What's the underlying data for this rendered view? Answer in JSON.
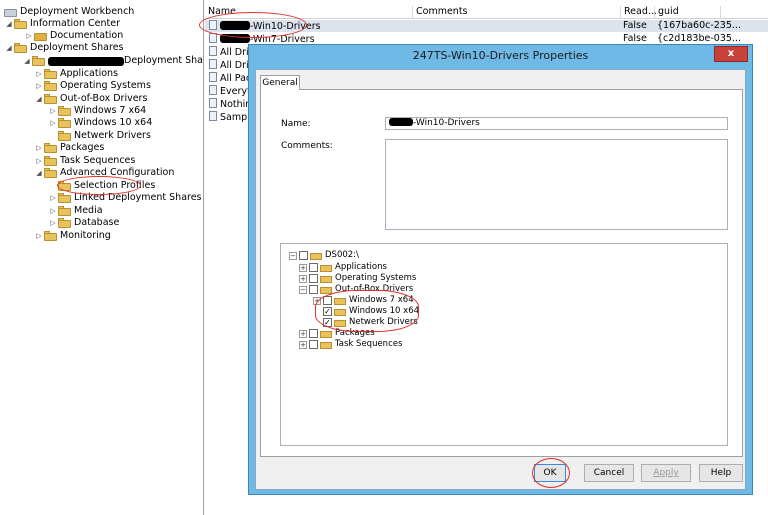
{
  "left_tree": {
    "items": [
      {
        "label": "Deployment Workbench",
        "icon": "workbench-icon"
      },
      {
        "label": "Information Center",
        "icon": "folder-icon"
      },
      {
        "label": "Documentation",
        "icon": "book-icon"
      },
      {
        "label": "Deployment Shares",
        "icon": "folder-icon"
      },
      {
        "label": "Deployment Share (D:\\WDS",
        "icon": "share-icon"
      },
      {
        "label": "Applications",
        "icon": "folder-icon"
      },
      {
        "label": "Operating Systems",
        "icon": "folder-icon"
      },
      {
        "label": "Out-of-Box Drivers",
        "icon": "folder-icon"
      },
      {
        "label": "Windows 7 x64",
        "icon": "folder-icon"
      },
      {
        "label": "Windows 10 x64",
        "icon": "folder-icon"
      },
      {
        "label": "Netwerk Drivers",
        "icon": "folder-icon"
      },
      {
        "label": "Packages",
        "icon": "folder-icon"
      },
      {
        "label": "Task Sequences",
        "icon": "folder-icon"
      },
      {
        "label": "Advanced Configuration",
        "icon": "folder-icon"
      },
      {
        "label": "Selection Profiles",
        "icon": "folder-icon"
      },
      {
        "label": "Linked Deployment Shares",
        "icon": "folder-icon"
      },
      {
        "label": "Media",
        "icon": "folder-icon"
      },
      {
        "label": "Database",
        "icon": "folder-icon"
      },
      {
        "label": "Monitoring",
        "icon": "folder-icon"
      }
    ]
  },
  "list": {
    "columns": [
      "Name",
      "Comments",
      "Read...",
      "guid"
    ],
    "rows": [
      {
        "name": "-Win10-Drivers",
        "read": "False",
        "guid": "{167ba60c-235..."
      },
      {
        "name": "-Win7-Drivers",
        "read": "False",
        "guid": "{c2d183be-035..."
      },
      {
        "name": "All Driv",
        "read": "",
        "guid": ""
      },
      {
        "name": "All Driv",
        "read": "",
        "guid": ""
      },
      {
        "name": "All Pack",
        "read": "",
        "guid": ""
      },
      {
        "name": "Everyth",
        "read": "",
        "guid": ""
      },
      {
        "name": "Nothin",
        "read": "",
        "guid": ""
      },
      {
        "name": "Sample",
        "read": "",
        "guid": ""
      }
    ]
  },
  "dialog": {
    "title": "247TS-Win10-Drivers Properties",
    "close_label": "x",
    "tab_label": "General",
    "name_label": "Name:",
    "name_value": "-Win10-Drivers",
    "comments_label": "Comments:",
    "tree": [
      {
        "label": "DS002:\\",
        "checked": false
      },
      {
        "label": "Applications",
        "checked": false
      },
      {
        "label": "Operating Systems",
        "checked": false
      },
      {
        "label": "Out-of-Box Drivers",
        "checked": false
      },
      {
        "label": "Windows 7 x64",
        "checked": false
      },
      {
        "label": "Windows 10 x64",
        "checked": true
      },
      {
        "label": "Netwerk Drivers",
        "checked": true
      },
      {
        "label": "Packages",
        "checked": false
      },
      {
        "label": "Task Sequences",
        "checked": false
      }
    ],
    "buttons": {
      "ok": "OK",
      "cancel": "Cancel",
      "apply": "Apply",
      "help": "Help"
    }
  },
  "colors": {
    "annotation_red": "#e0302a",
    "title_bar": "#6fb9e6",
    "close_button": "#c7423a",
    "folder": "#e8c25a"
  }
}
